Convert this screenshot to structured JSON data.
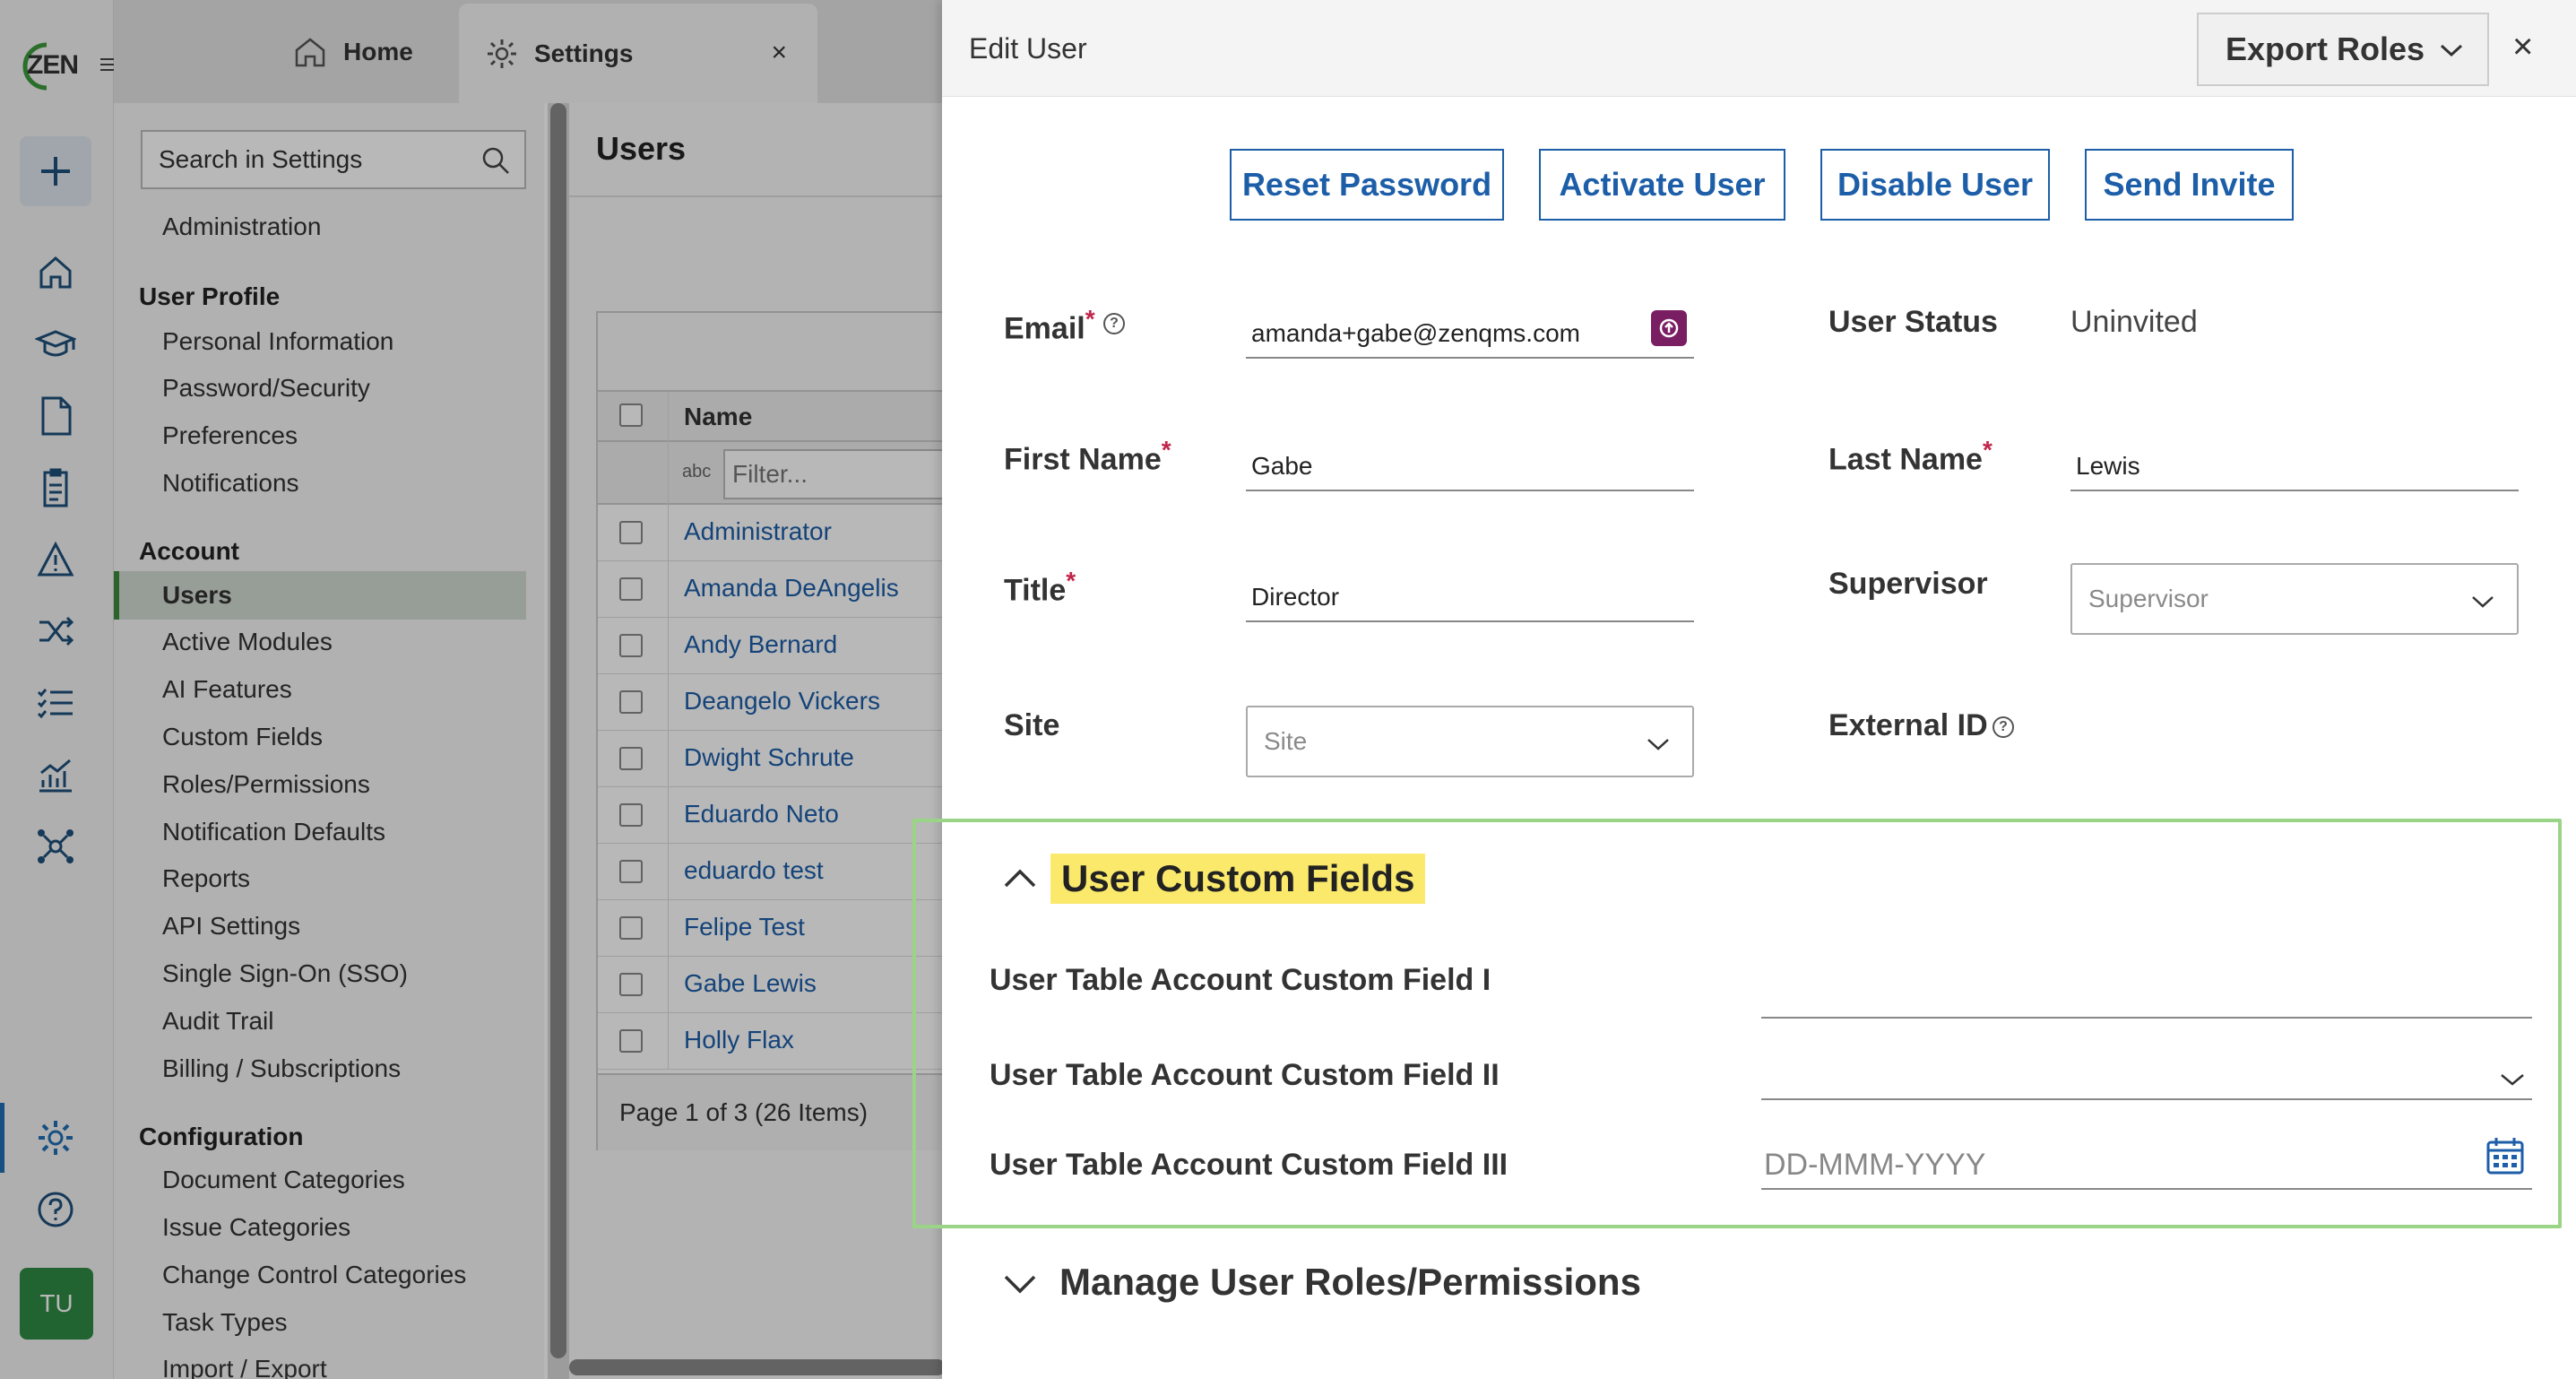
{
  "rail": {
    "logo": "ZEN",
    "avatar": "TU",
    "icons": [
      "add-icon",
      "home-icon",
      "graduation-cap-icon",
      "document-icon",
      "clipboard-icon",
      "warning-icon",
      "shuffle-icon",
      "checklist-icon",
      "analytics-icon",
      "network-icon",
      "gear-icon",
      "help-icon"
    ]
  },
  "tabs": {
    "home": "Home",
    "settings": "Settings",
    "close": "×"
  },
  "sidebar": {
    "search_placeholder": "Search in Settings",
    "administration": "Administration",
    "user_profile_head": "User Profile",
    "user_profile_items": [
      "Personal Information",
      "Password/Security",
      "Preferences",
      "Notifications"
    ],
    "account_head": "Account",
    "account_items": [
      "Users",
      "Active Modules",
      "AI Features",
      "Custom Fields",
      "Roles/Permissions",
      "Notification Defaults",
      "Reports",
      "API Settings",
      "Single Sign-On (SSO)",
      "Audit Trail",
      "Billing / Subscriptions"
    ],
    "configuration_head": "Configuration",
    "configuration_items": [
      "Document Categories",
      "Issue Categories",
      "Change Control Categories",
      "Task Types",
      "Import / Export"
    ]
  },
  "users": {
    "title": "Users",
    "column_name": "Name",
    "filter_icon_text": "abc",
    "filter_placeholder": "Filter...",
    "rows": [
      "Administrator",
      "Amanda DeAngelis",
      "Andy Bernard",
      "Deangelo Vickers",
      "Dwight Schrute",
      "Eduardo Neto",
      "eduardo test",
      "Felipe Test",
      "Gabe Lewis",
      "Holly Flax"
    ],
    "pager": "Page 1 of 3 (26 Items)"
  },
  "panel": {
    "title": "Edit User",
    "export_label": "Export Roles",
    "close": "×",
    "actions": [
      "Reset Password",
      "Activate User",
      "Disable User",
      "Send Invite"
    ],
    "email_label": "Email",
    "email_value": "amanda+gabe@zenqms.com",
    "user_status_label": "User Status",
    "user_status_value": "Uninvited",
    "first_name_label": "First Name",
    "first_name_value": "Gabe",
    "last_name_label": "Last Name",
    "last_name_value": "Lewis",
    "title_label": "Title",
    "title_value": "Director",
    "supervisor_label": "Supervisor",
    "supervisor_placeholder": "Supervisor",
    "site_label": "Site",
    "site_placeholder": "Site",
    "external_id_label": "External ID",
    "required_mark": "*",
    "help_mark": "?"
  },
  "custom_fields": {
    "title": "User Custom Fields",
    "field1": "User Table Account Custom Field I",
    "field2": "User Table Account Custom Field II",
    "field3": "User Table Account Custom Field III",
    "date_placeholder": "DD-MMM-YYYY"
  },
  "roles_section": {
    "title": "Manage User Roles/Permissions"
  },
  "colors": {
    "accent_blue": "#1d5ea8",
    "brand_green": "#2f8a44",
    "highlight_yellow": "#fbe96c",
    "box_green": "#9ad486",
    "required_red": "#c0264b"
  }
}
